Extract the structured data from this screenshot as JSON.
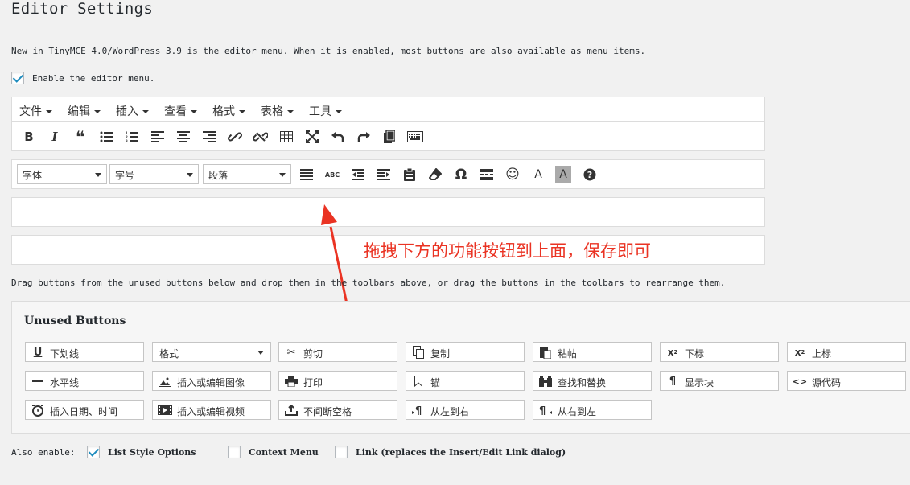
{
  "page": {
    "title": "Editor Settings",
    "intro": "New in TinyMCE 4.0/WordPress 3.9 is the editor menu. When it is enabled, most buttons are also available as menu items.",
    "enable_menu_label": "Enable the editor menu.",
    "drag_hint": "Drag buttons from the unused buttons below and drop them in the toolbars above, or drag the buttons in the toolbars to rearrange them.",
    "annotation": "拖拽下方的功能按钮到上面，保存即可"
  },
  "menubar": [
    "文件",
    "编辑",
    "插入",
    "查看",
    "格式",
    "表格",
    "工具"
  ],
  "toolbar2": {
    "font_family": "字体",
    "font_size": "字号",
    "paragraph": "段落"
  },
  "unused": {
    "title": "Unused Buttons",
    "buttons": [
      {
        "label": "下划线",
        "icon": "underline-icon"
      },
      {
        "label": "格式",
        "icon": "select"
      },
      {
        "label": "剪切",
        "icon": "scissors-icon"
      },
      {
        "label": "复制",
        "icon": "copy-icon"
      },
      {
        "label": "粘帖",
        "icon": "paste-icon"
      },
      {
        "label": "下标",
        "icon": "subscript-icon"
      },
      {
        "label": "上标",
        "icon": "superscript-icon"
      },
      {
        "label": "水平线",
        "icon": "hr-icon"
      },
      {
        "label": "插入或编辑图像",
        "icon": "image-icon"
      },
      {
        "label": "打印",
        "icon": "print-icon"
      },
      {
        "label": "锚",
        "icon": "bookmark-icon"
      },
      {
        "label": "查找和替换",
        "icon": "binoculars-icon"
      },
      {
        "label": "显示块",
        "icon": "pilcrow-icon"
      },
      {
        "label": "源代码",
        "icon": "code-icon"
      },
      {
        "label": "插入日期、时间",
        "icon": "clock-icon"
      },
      {
        "label": "插入或编辑视频",
        "icon": "video-icon"
      },
      {
        "label": "不间断空格",
        "icon": "nbsp-icon"
      },
      {
        "label": "从左到右",
        "icon": "ltr-icon"
      },
      {
        "label": "从右到左",
        "icon": "rtl-icon"
      }
    ]
  },
  "also": {
    "label": "Also enable:",
    "list_style": "List Style Options",
    "context_menu": "Context Menu",
    "link": "Link (replaces the Insert/Edit Link dialog)"
  },
  "colors": {
    "annotation": "#ea3323",
    "checkbox": "#1e8cbe"
  }
}
